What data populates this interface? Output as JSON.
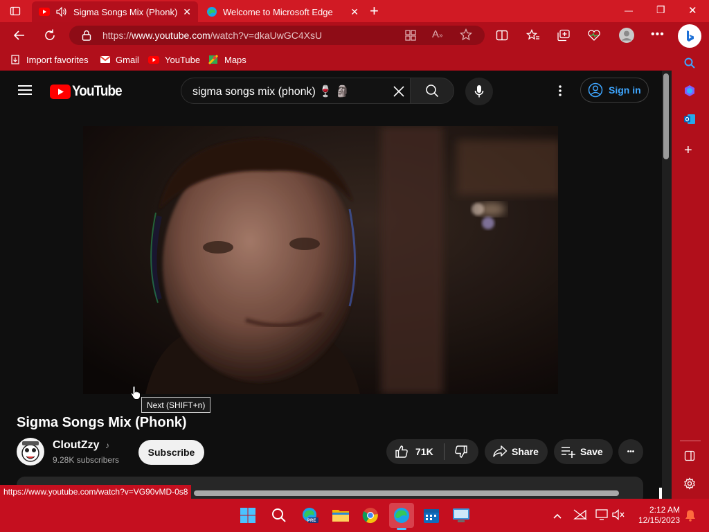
{
  "tabs": [
    {
      "title": "Sigma Songs Mix (Phonk) -",
      "close": "✕"
    },
    {
      "title": "Welcome to Microsoft Edge",
      "close": "✕"
    }
  ],
  "new_tab": "+",
  "window_controls": {
    "minimize": "—",
    "restore": "❐",
    "close": "✕"
  },
  "address": {
    "prefix": "https://",
    "host": "www.youtube.com",
    "path": "/watch?v=dkaUwGC4XsU"
  },
  "favorites": [
    "Import favorites",
    "Gmail",
    "YouTube",
    "Maps"
  ],
  "youtube": {
    "logo_text": "YouTube",
    "search_value": "sigma songs mix (phonk) 🍷 🗿",
    "sign_in": "Sign in",
    "tooltip": "Next (SHIFT+n)",
    "video_title": "Sigma Songs Mix (Phonk)",
    "channel_name": "CloutZzy",
    "channel_badge": "♪",
    "subscribers": "9.28K subscribers",
    "subscribe": "Subscribe",
    "likes": "71K",
    "share": "Share",
    "save": "Save",
    "more": "•••"
  },
  "status_url": "https://www.youtube.com/watch?v=VG90vMD-0s8",
  "taskbar": {
    "time": "2:12 AM",
    "date": "12/15/2023",
    "edge_badge": "PRE"
  },
  "colors": {
    "edge_theme": "#c50f1f",
    "youtube_red": "#ff0000",
    "subscribe_bg": "#f1f1f1",
    "signin_blue": "#3ea6ff"
  }
}
